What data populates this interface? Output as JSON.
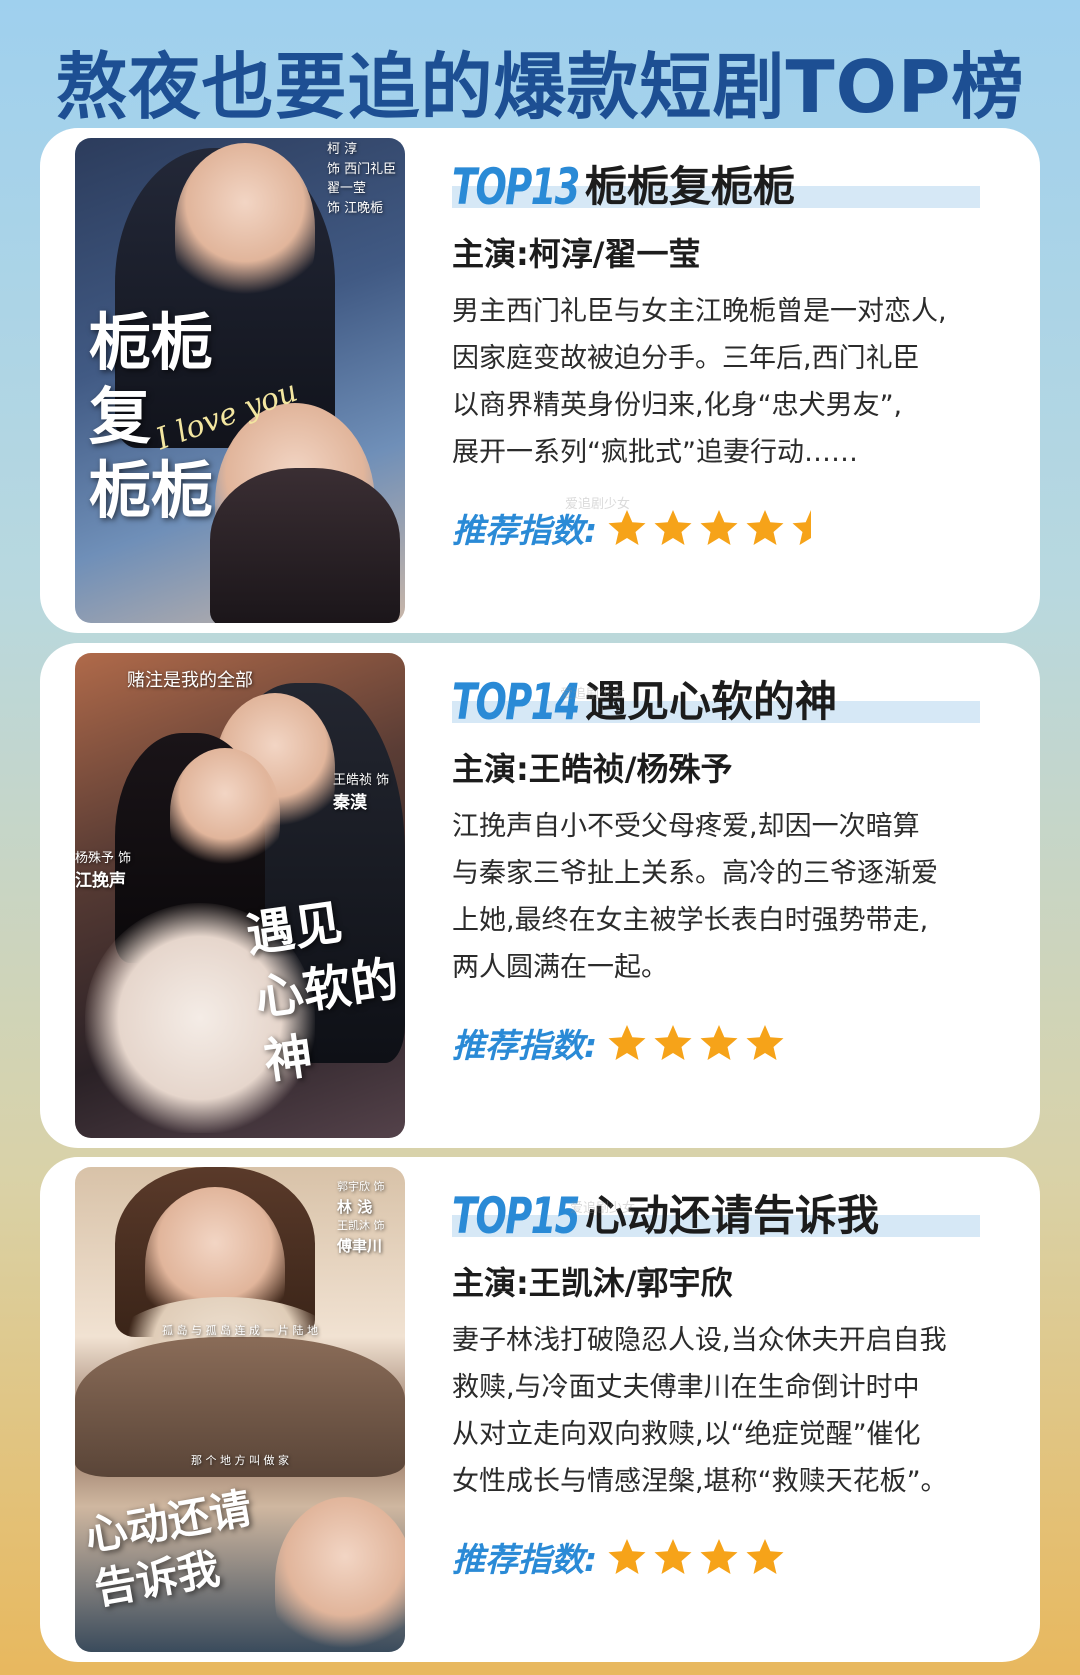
{
  "page_title": "熬夜也要追的爆款短剧TOP榜",
  "rating_label": "推荐指数:",
  "watermark": "爱追剧少女",
  "colors": {
    "title": "#1d4f93",
    "accent_blue": "#2a8ad6",
    "star": "#f6a319",
    "rank_highlight": "#d6e8f6"
  },
  "cards": [
    {
      "rank": "TOP13",
      "title": "栀栀复栀栀",
      "cast": "主演:柯淳/翟一莹",
      "synopsis": [
        "男主西门礼臣与女主江晚栀曾是一对恋人,",
        "因家庭变故被迫分手。三年后,西门礼臣",
        "以商界精英身份归来,化身“忠犬男友”,",
        "展开一系列“疯批式”追妻行动……"
      ],
      "rating": 4.5,
      "poster": {
        "calligraphy": [
          "栀栀",
          "复",
          "栀栀"
        ],
        "script": "I love you",
        "credits": [
          "柯  淳",
          "饰 西门礼臣",
          "翟一莹",
          "饰  江晚栀"
        ]
      }
    },
    {
      "rank": "TOP14",
      "title": "遇见心软的神",
      "cast": "主演:王皓祯/杨殊予",
      "synopsis": [
        "江挽声自小不受父母疼爱,却因一次暗算",
        "与秦家三爷扯上关系。高冷的三爷逐渐爱",
        "上她,最终在女主被学长表白时强势带走,",
        "两人圆满在一起。"
      ],
      "rating": 4,
      "poster": {
        "tagline": "赌注是我的全部",
        "calligraphy": [
          "遇见",
          "心软的",
          "神"
        ],
        "credits_right": [
          "王皓祯  饰",
          "秦漠"
        ],
        "credits_left": [
          "杨殊予  饰",
          "江挽声"
        ]
      }
    },
    {
      "rank": "TOP15",
      "title": "心动还请告诉我",
      "cast": "主演:王凯沐/郭宇欣",
      "synopsis": [
        "妻子林浅打破隐忍人设,当众休夫开启自我",
        "救赎,与冷面丈夫傅聿川在生命倒计时中",
        "从对立走向双向救赎,以“绝症觉醒”催化",
        "女性成长与情感涅槃,堪称“救赎天花板”。"
      ],
      "rating": 4,
      "poster": {
        "tagline_top": "孤 岛 与 孤 岛 连 成 一 片 陆 地",
        "tagline_mid": "那 个 地 方 叫 做 家",
        "calligraphy": [
          "心动还请",
          "告诉我"
        ],
        "credits": [
          "郭宇欣  饰",
          "林  浅",
          "王凯沐  饰",
          "傅聿川"
        ]
      }
    }
  ]
}
